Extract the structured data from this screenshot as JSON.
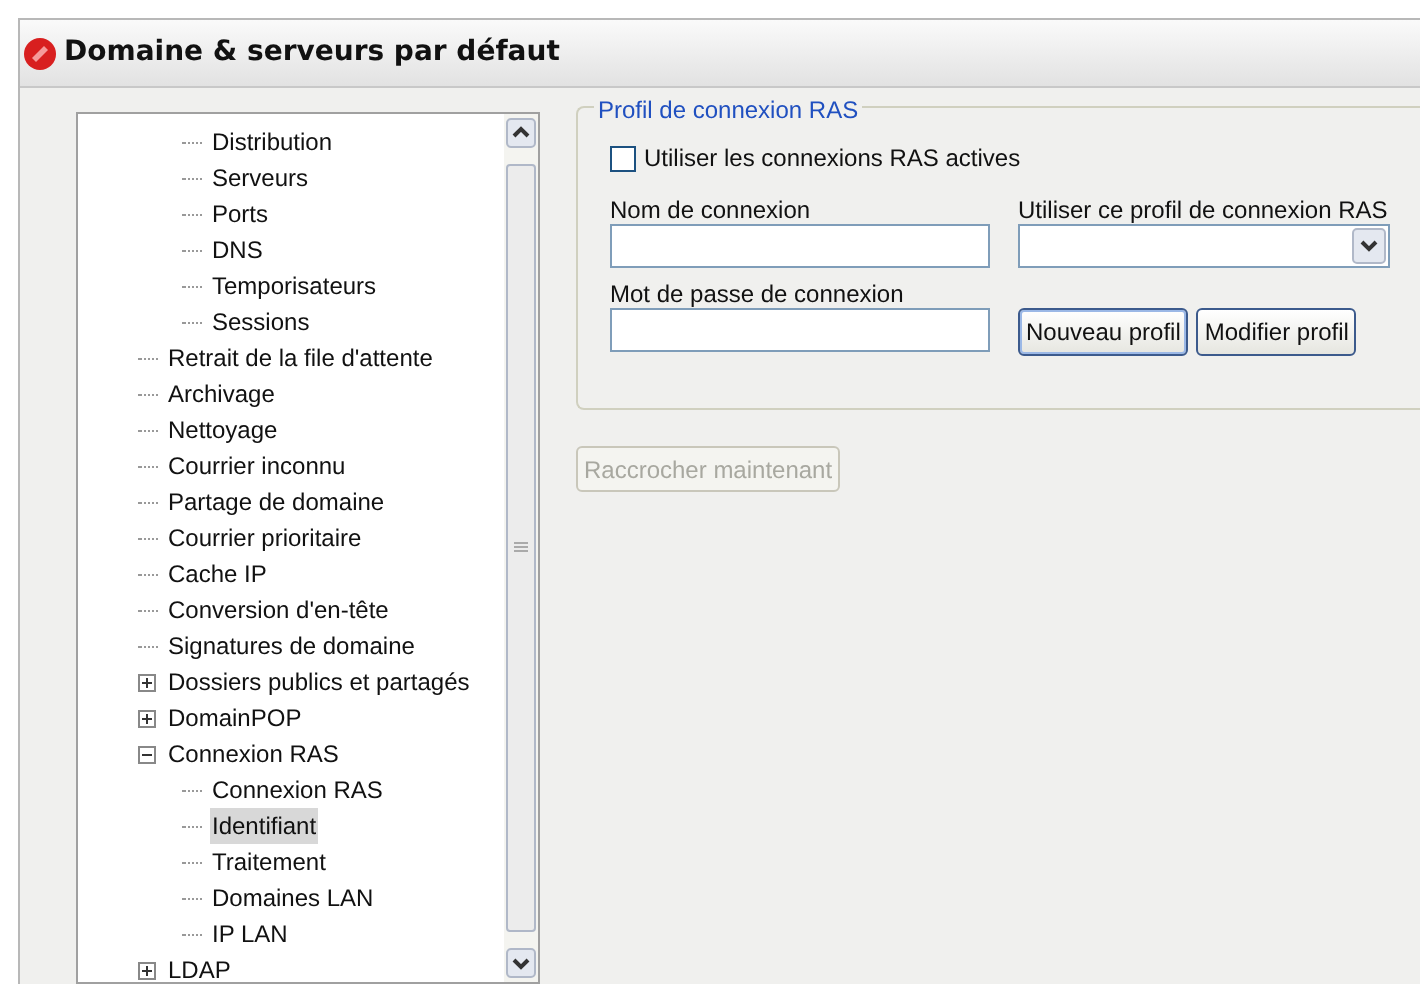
{
  "window": {
    "title": "Domaine & serveurs par défaut"
  },
  "tree": {
    "items": [
      {
        "children": [
          {
            "label": "Distribution",
            "selected": false
          },
          {
            "label": "Serveurs",
            "selected": false
          },
          {
            "label": "Ports",
            "selected": false
          },
          {
            "label": "DNS",
            "selected": false
          },
          {
            "label": "Temporisateurs",
            "selected": false
          },
          {
            "label": "Sessions",
            "selected": false
          }
        ]
      },
      {
        "label": "Retrait de la file d'attente",
        "selected": false
      },
      {
        "label": "Archivage",
        "selected": false
      },
      {
        "label": "Nettoyage",
        "selected": false
      },
      {
        "label": "Courrier inconnu",
        "selected": false
      },
      {
        "label": "Partage de domaine",
        "selected": false
      },
      {
        "label": "Courrier prioritaire",
        "selected": false
      },
      {
        "label": "Cache IP",
        "selected": false
      },
      {
        "label": "Conversion d'en-tête",
        "selected": false
      },
      {
        "label": "Signatures de domaine",
        "selected": false
      },
      {
        "label": "Dossiers publics et partagés",
        "selected": false,
        "expanded": false
      },
      {
        "label": "DomainPOP",
        "selected": false,
        "expanded": false
      },
      {
        "label": "Connexion RAS",
        "selected": false,
        "expanded": true,
        "children": [
          {
            "label": "Connexion RAS",
            "selected": false
          },
          {
            "label": "Identifiant",
            "selected": true
          },
          {
            "label": "Traitement",
            "selected": false
          },
          {
            "label": "Domaines LAN",
            "selected": false
          },
          {
            "label": "IP LAN",
            "selected": false
          }
        ]
      },
      {
        "label": "LDAP",
        "selected": false,
        "expanded": false
      }
    ]
  },
  "group": {
    "legend": "Profil de connexion RAS",
    "checkbox": {
      "label": "Utiliser les connexions RAS actives",
      "checked": false
    },
    "name_label": "Nom de connexion",
    "profile_label": "Utiliser ce profil de connexion RAS",
    "password_label": "Mot de passe de connexion",
    "buttons": [
      {
        "label": "Nouveau profil",
        "focused": true
      },
      {
        "label": "Modifier profil",
        "focused": false
      }
    ]
  },
  "hangup_button": {
    "label": "Raccrocher maintenant",
    "disabled": true
  }
}
